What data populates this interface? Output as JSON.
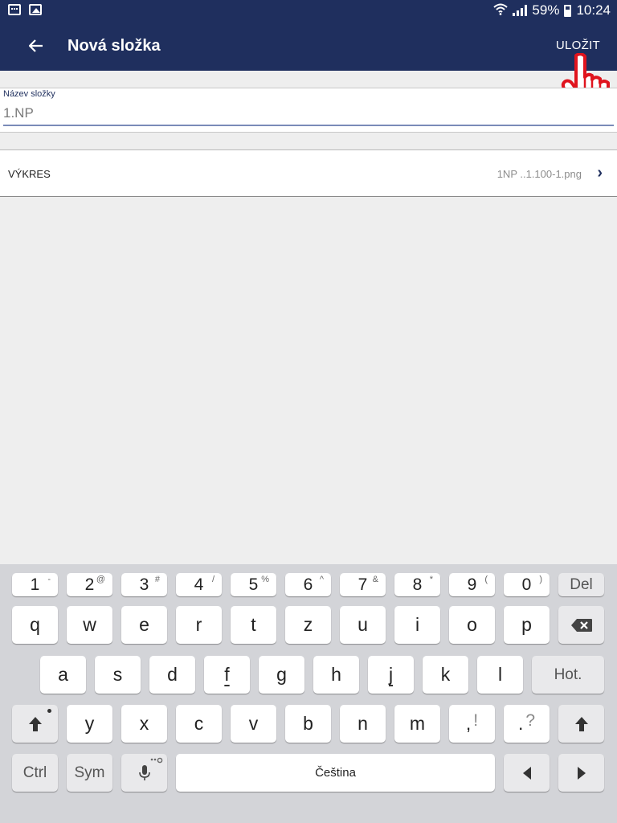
{
  "status_bar": {
    "battery": "59%",
    "time": "10:24"
  },
  "app_bar": {
    "title": "Nová složka",
    "save_label": "ULOŽIT"
  },
  "folder_name_field": {
    "label": "Název složky",
    "value": "1.NP"
  },
  "drawing_row": {
    "label": "VÝKRES",
    "value": "1NP ..1.100-1.png"
  },
  "keyboard": {
    "number_row": [
      {
        "main": "1",
        "alt": "-"
      },
      {
        "main": "2",
        "alt": "@"
      },
      {
        "main": "3",
        "alt": "#"
      },
      {
        "main": "4",
        "alt": "/"
      },
      {
        "main": "5",
        "alt": "%"
      },
      {
        "main": "6",
        "alt": "^"
      },
      {
        "main": "7",
        "alt": "&"
      },
      {
        "main": "8",
        "alt": "*"
      },
      {
        "main": "9",
        "alt": "("
      },
      {
        "main": "0",
        "alt": ")"
      }
    ],
    "del_label": "Del",
    "row1": [
      "q",
      "w",
      "e",
      "r",
      "t",
      "z",
      "u",
      "i",
      "o",
      "p"
    ],
    "row2": [
      "a",
      "s",
      "d",
      "f",
      "g",
      "h",
      "j",
      "k",
      "l"
    ],
    "enter_label": "Hot.",
    "row3": [
      "y",
      "x",
      "c",
      "v",
      "b",
      "n",
      "m"
    ],
    "comma_key": {
      "main": ",",
      "alt": "!"
    },
    "period_key": {
      "main": ".",
      "alt": "?"
    },
    "ctrl_label": "Ctrl",
    "sym_label": "Sym",
    "space_label": "Čeština"
  },
  "colors": {
    "app_bar": "#1f2f5e",
    "keyboard_bg": "#d3d4d8",
    "hand_pointer": "#e0141e"
  }
}
